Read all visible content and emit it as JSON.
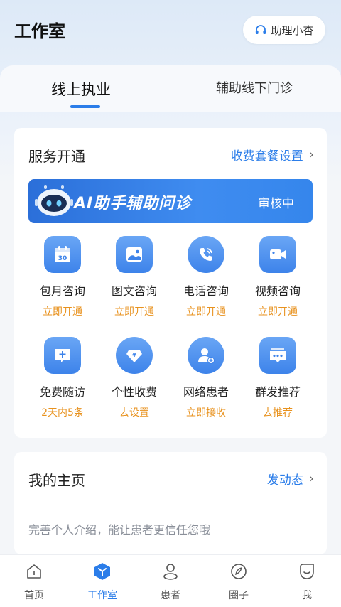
{
  "header": {
    "title": "工作室",
    "assistant_label": "助理小杏"
  },
  "tabs": [
    {
      "label": "线上执业",
      "active": true
    },
    {
      "label": "辅助线下门诊",
      "active": false
    }
  ],
  "service_card": {
    "title": "服务开通",
    "link_label": "收费套餐设置",
    "ai_banner": {
      "title": "AI助手辅助问诊",
      "status": "审核中"
    },
    "items": [
      {
        "label": "包月咨询",
        "action": "立即开通",
        "icon": "calendar-icon"
      },
      {
        "label": "图文咨询",
        "action": "立即开通",
        "icon": "image-icon"
      },
      {
        "label": "电话咨询",
        "action": "立即开通",
        "icon": "phone-icon"
      },
      {
        "label": "视频咨询",
        "action": "立即开通",
        "icon": "video-icon"
      },
      {
        "label": "免费随访",
        "action": "2天内5条",
        "icon": "message-plus-icon"
      },
      {
        "label": "个性收费",
        "action": "去设置",
        "icon": "price-tag-icon"
      },
      {
        "label": "网络患者",
        "action": "立即接收",
        "icon": "patient-add-icon"
      },
      {
        "label": "群发推荐",
        "action": "去推荐",
        "icon": "group-message-icon"
      }
    ]
  },
  "home_card": {
    "title": "我的主页",
    "link_label": "发动态",
    "hint": "完善个人介绍，能让患者更信任您哦"
  },
  "bottom_nav": [
    {
      "label": "首页",
      "icon": "home-icon",
      "active": false
    },
    {
      "label": "工作室",
      "icon": "studio-icon",
      "active": true
    },
    {
      "label": "患者",
      "icon": "patient-icon",
      "active": false
    },
    {
      "label": "圈子",
      "icon": "circle-icon",
      "active": false
    },
    {
      "label": "我",
      "icon": "profile-icon",
      "active": false
    }
  ],
  "colors": {
    "accent": "#2b7de9",
    "action_orange": "#e8921e"
  }
}
